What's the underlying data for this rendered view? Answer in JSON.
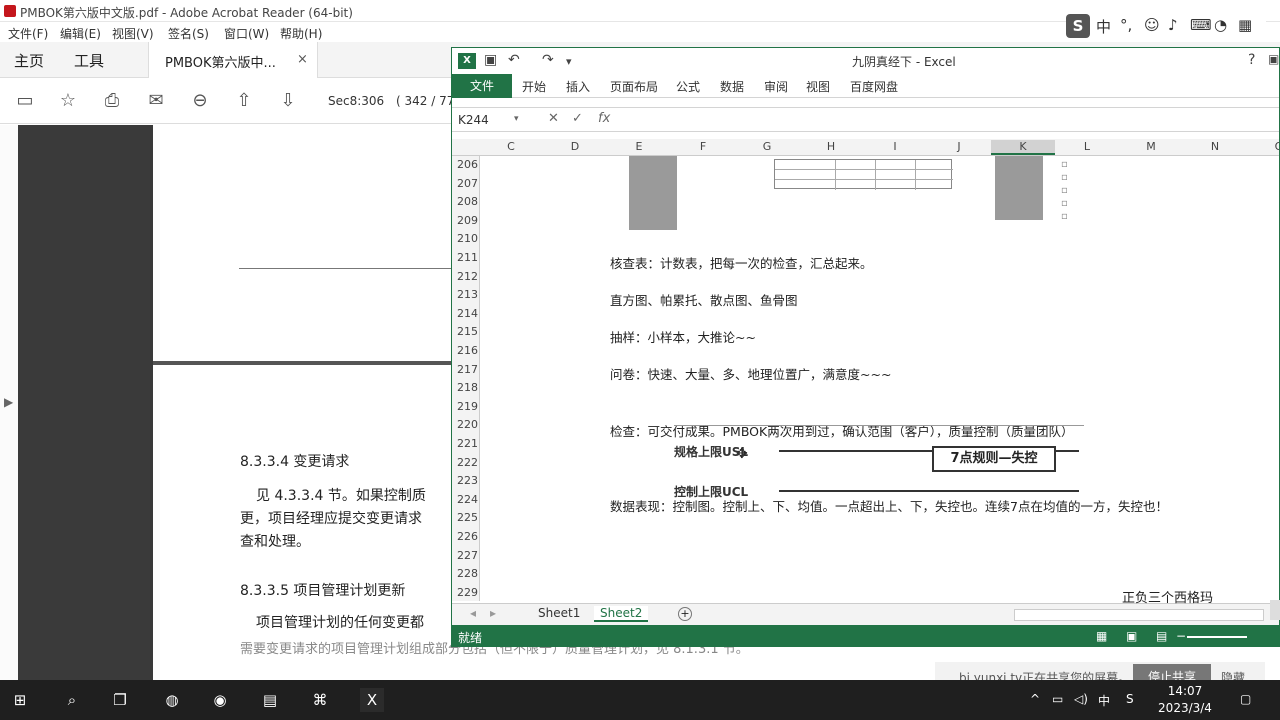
{
  "acrobat": {
    "title": "PMBOK第六版中文版.pdf - Adobe Acrobat Reader (64-bit)",
    "menu": [
      "文件(F)",
      "编辑(E)",
      "视图(V)",
      "签名(S)",
      "窗口(W)",
      "帮助(H)"
    ],
    "tabs": {
      "home": "主页",
      "tools": "工具",
      "doc": "PMBOK第六版中...",
      "close": "×"
    },
    "page_label": "Sec8:306",
    "page_count": "( 342 / 77",
    "body": [
      "8.3.3.4 变更请求",
      "见 4.3.3.4 节。如果控制质",
      "更，项目经理应提交变更请求",
      "查和处理。",
      "8.3.3.5 项目管理计划更新",
      "项目管理计划的任何变更都",
      "需要变更请求的项目管理计划组成部分包括（但不限于）质量管理计划，见 8.1.3.1 节。"
    ]
  },
  "excel": {
    "title": "九阴真经下 - Excel",
    "help": "?",
    "ribbon_tabs": [
      "文件",
      "开始",
      "插入",
      "页面布局",
      "公式",
      "数据",
      "审阅",
      "视图",
      "百度网盘"
    ],
    "name_box": "K244",
    "fx": "fx",
    "columns": [
      "C",
      "D",
      "E",
      "F",
      "G",
      "H",
      "I",
      "J",
      "K",
      "L",
      "M",
      "N",
      "O"
    ],
    "selected_column": "K",
    "rows": [
      "206",
      "207",
      "208",
      "209",
      "210",
      "211",
      "212",
      "213",
      "214",
      "215",
      "216",
      "217",
      "218",
      "219",
      "220",
      "221",
      "222",
      "223",
      "224",
      "225",
      "226",
      "227",
      "228",
      "229"
    ],
    "cells": {
      "r211": "核查表：计数表，把每一次的检查，汇总起来。",
      "r213": "直方图、帕累托、散点图、鱼骨图",
      "r215": "抽样：小样本，大推论~~",
      "r217": "问卷：快速、大量、多、地理位置广，满意度~~~",
      "r220": "检查：可交付成果。PMBOK两次用到过，确认范围（客户），质量控制（质量团队）",
      "r224": "数据表现：控制图。控制上、下、均值。一点超出上、下，失控也。连续7点在均值的一方，失控也！"
    },
    "chart": {
      "usl": "规格上限USL",
      "ucl": "控制上限UCL",
      "rule": "7点规则—失控"
    },
    "sheets": [
      "Sheet1",
      "Sheet2"
    ],
    "active_sheet": "Sheet2",
    "add_sheet": "+",
    "status": "就绪",
    "accent": "#217346"
  },
  "side_note": "正负三个西格玛",
  "notification": {
    "text": "bj.yunxi.tv正在共享您的屏幕。",
    "button": "停止共享",
    "hide": "隐藏"
  },
  "ime": {
    "logo": "S",
    "lang": "中",
    "punct": "°,",
    "emoji": "☺"
  },
  "taskbar": {
    "time": "14:07",
    "date": "2023/3/4",
    "lang": "中",
    "icons": [
      "windows-icon",
      "search-icon",
      "task-view-icon",
      "browser-icon",
      "chrome-icon",
      "explorer-icon",
      "acrobat-icon",
      "excel-icon"
    ]
  }
}
